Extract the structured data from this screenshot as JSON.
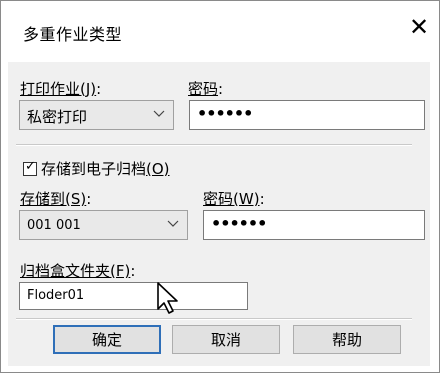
{
  "dialog": {
    "title": "多重作业类型",
    "close_glyph": "✕",
    "print_job": {
      "label": "打印作业",
      "hotkey": "(J)",
      "colon": ":",
      "value": "私密打印"
    },
    "password_1": {
      "label": "密码",
      "colon": ":",
      "value": "••••••"
    },
    "store_checkbox": {
      "label": "存储到电子归档",
      "hotkey": "(O)",
      "checked": true,
      "check_glyph": "✓"
    },
    "store_to": {
      "label": "存储到",
      "hotkey": "(S)",
      "colon": ":",
      "value": "001 001"
    },
    "password_2": {
      "label": "密码",
      "hotkey": "(W)",
      "colon": ":",
      "value": "••••••"
    },
    "folder": {
      "label": "归档盒文件夹",
      "hotkey": "(F)",
      "colon": ":",
      "value": "Floder01"
    },
    "buttons": {
      "ok": "确定",
      "cancel": "取消",
      "help": "帮助"
    }
  },
  "icons": {
    "chevron": "chevron-down-icon",
    "cursor": "mouse-pointer-icon"
  }
}
